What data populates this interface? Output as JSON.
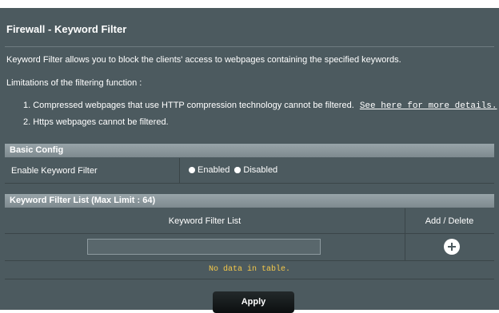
{
  "page": {
    "title": "Firewall - Keyword Filter",
    "description": "Keyword Filter allows you to block the clients' access to webpages containing the specified keywords.",
    "limitations_heading": "Limitations of the filtering function :",
    "limitation_1": "1. Compressed webpages that use HTTP compression technology cannot be filtered.",
    "limitation_1_link": "See here for more details.",
    "limitation_2": "2. Https webpages cannot be filtered."
  },
  "basic_config": {
    "header": "Basic Config",
    "enable_label": "Enable Keyword Filter",
    "option_enabled": "Enabled",
    "option_disabled": "Disabled",
    "selected": "Disabled"
  },
  "keyword_list": {
    "header": "Keyword Filter List (Max Limit : 64)",
    "col_keyword": "Keyword Filter List",
    "col_add_delete": "Add / Delete",
    "input_value": "",
    "empty_message": "No data in table."
  },
  "actions": {
    "apply_label": "Apply"
  },
  "colors": {
    "panel_bg": "#4c5a5f",
    "empty_text": "#f4c84a"
  }
}
